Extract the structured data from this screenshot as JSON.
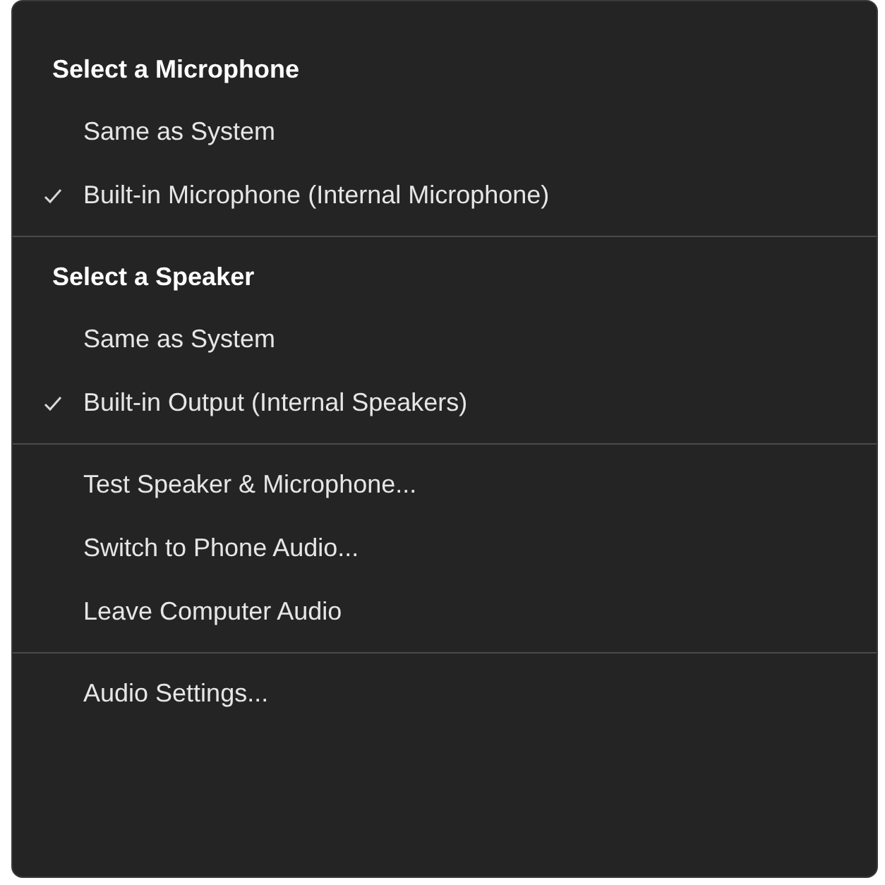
{
  "menu": {
    "sections": [
      {
        "header": "Select a Microphone",
        "items": [
          {
            "kind": "option",
            "label": "Same as System",
            "selected": false
          },
          {
            "kind": "option",
            "label": "Built-in Microphone (Internal Microphone)",
            "selected": true
          }
        ]
      },
      {
        "header": "Select a Speaker",
        "items": [
          {
            "kind": "option",
            "label": "Same as System",
            "selected": false
          },
          {
            "kind": "option",
            "label": "Built-in Output (Internal Speakers)",
            "selected": true
          }
        ]
      },
      {
        "items": [
          {
            "kind": "action",
            "label": "Test Speaker & Microphone..."
          },
          {
            "kind": "action",
            "label": "Switch to Phone Audio..."
          },
          {
            "kind": "action",
            "label": "Leave Computer Audio"
          }
        ]
      },
      {
        "items": [
          {
            "kind": "action",
            "label": "Audio Settings..."
          }
        ]
      }
    ]
  }
}
